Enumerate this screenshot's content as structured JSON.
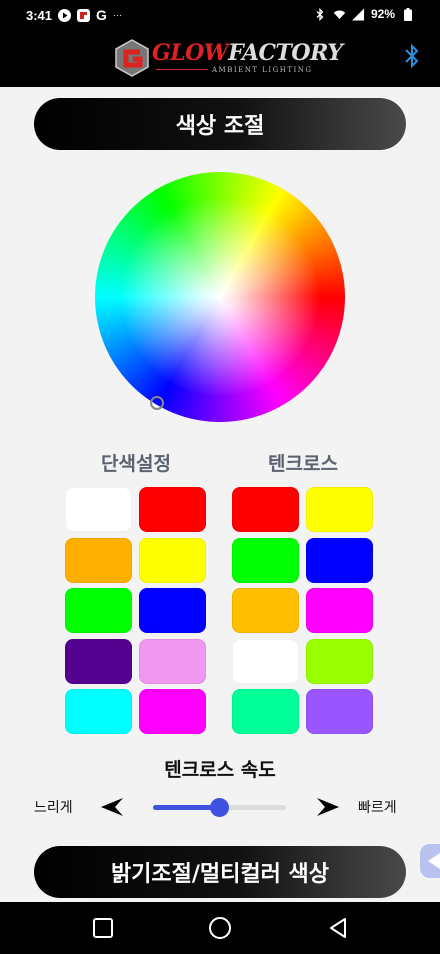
{
  "status_bar": {
    "time": "3:41",
    "battery": "92%",
    "notif_g": "G",
    "notif_more": "···",
    "icons": [
      "play-icon",
      "app-icon",
      "google-icon",
      "bluetooth-icon",
      "wifi-icon",
      "signal-icon",
      "battery-icon"
    ]
  },
  "header": {
    "logo_word_glow": "GLOW",
    "logo_word_factory": "FACTORY",
    "logo_sub": "AMBIENT LIGHTING",
    "bluetooth_icon": "bluetooth-icon",
    "bluetooth_color": "#2a8fd8"
  },
  "color_section": {
    "title": "색상 조절"
  },
  "solid_colors": {
    "title": "단색설정",
    "swatches": [
      "#ffffff",
      "#fe0000",
      "#ffaf00",
      "#ffff00",
      "#00ff00",
      "#0000ff",
      "#550190",
      "#f097f0",
      "#00ffff",
      "#ff00ff"
    ]
  },
  "techno": {
    "title": "텐크로스",
    "swatches": [
      "#fe0000",
      "#ffff00",
      "#00ff00",
      "#0000ff",
      "#ffbf00",
      "#ff00ff",
      "#ffffff",
      "#99ff00",
      "#00ff99",
      "#9955ff"
    ]
  },
  "speed": {
    "title": "텐크로스 속도",
    "slow_label": "느리게",
    "fast_label": "빠르게",
    "value_fraction": 0.5,
    "accent": "#3f51e0"
  },
  "brightness_section": {
    "title": "밝기조절/멀티컬러 색상"
  },
  "nav": {
    "icons": [
      "recent-apps-icon",
      "home-icon",
      "back-icon"
    ]
  }
}
